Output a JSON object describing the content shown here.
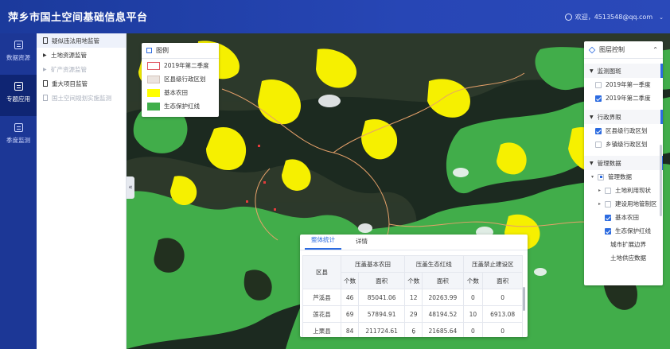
{
  "header": {
    "title": "萍乡市国土空间基础信息平台",
    "user_label": "欢迎，4513548@qq.com"
  },
  "leftnav": [
    {
      "label": "数据资源",
      "icon": "database-icon",
      "active": false
    },
    {
      "label": "专题应用",
      "icon": "document-icon",
      "active": true
    },
    {
      "label": "季度监测",
      "icon": "monitor-icon",
      "active": false
    }
  ],
  "subnav": [
    {
      "label": "疑似违法用地监管",
      "kind": "doc",
      "highlight": true
    },
    {
      "label": "土地资源监管",
      "kind": "arrow"
    },
    {
      "label": "矿产资源监管",
      "kind": "arrow",
      "disabled": true
    },
    {
      "label": "重大项目监管",
      "kind": "doc"
    },
    {
      "label": "国土空间规划实施监测",
      "kind": "doc",
      "disabled": true
    }
  ],
  "legend": {
    "title": "图例",
    "items": [
      {
        "label": "2019年第二季度",
        "color": "#e05560",
        "style": "outline"
      },
      {
        "label": "区县级行政区划",
        "color": "#e9e1dc",
        "style": "fill"
      },
      {
        "label": "基本农田",
        "color": "#ffff00",
        "style": "fill"
      },
      {
        "label": "生态保护红线",
        "color": "#3fae4a",
        "style": "fill"
      }
    ]
  },
  "layers": {
    "title": "图层控制",
    "sections": [
      {
        "title": "监测图斑",
        "items": [
          {
            "label": "2019年第一季度",
            "checked": false
          },
          {
            "label": "2019年第二季度",
            "checked": true
          }
        ]
      },
      {
        "title": "行政界限",
        "items": [
          {
            "label": "区县级行政区划",
            "checked": true
          },
          {
            "label": "乡镇级行政区划",
            "checked": false
          }
        ]
      },
      {
        "title": "管理数据",
        "items": []
      }
    ],
    "tree_root": "管理数据",
    "tree": [
      {
        "label": "土地利用现状",
        "checked": false,
        "arrow": true
      },
      {
        "label": "建设用地管制区",
        "checked": false,
        "arrow": true
      },
      {
        "label": "基本农田",
        "checked": true,
        "arrow": false
      },
      {
        "label": "生态保护红线",
        "checked": true,
        "arrow": false
      },
      {
        "label": "城市扩展边界",
        "checked": false,
        "arrow": false,
        "nobox": true
      },
      {
        "label": "土地供应数据",
        "checked": false,
        "arrow": false,
        "nobox": true
      }
    ]
  },
  "stats": {
    "tabs": [
      "整体统计",
      "详情"
    ],
    "active_tab": 0,
    "col_region": "区县",
    "groups": [
      "压盖基本农田",
      "压盖生态红线",
      "压盖禁止建设区"
    ],
    "subcols": [
      "个数",
      "面积"
    ],
    "rows": [
      {
        "region": "芦溪县",
        "v": [
          "46",
          "85041.06",
          "12",
          "20263.99",
          "0",
          "0"
        ]
      },
      {
        "region": "莲花县",
        "v": [
          "69",
          "57894.91",
          "29",
          "48194.52",
          "10",
          "6913.08"
        ]
      },
      {
        "region": "上栗县",
        "v": [
          "84",
          "211724.61",
          "6",
          "21685.64",
          "0",
          "0"
        ]
      }
    ]
  },
  "colors": {
    "header": "#2746b5",
    "nav": "#1c3796",
    "accent": "#2c6be0",
    "farmland": "#ffff00",
    "eco": "#3fae4a"
  }
}
